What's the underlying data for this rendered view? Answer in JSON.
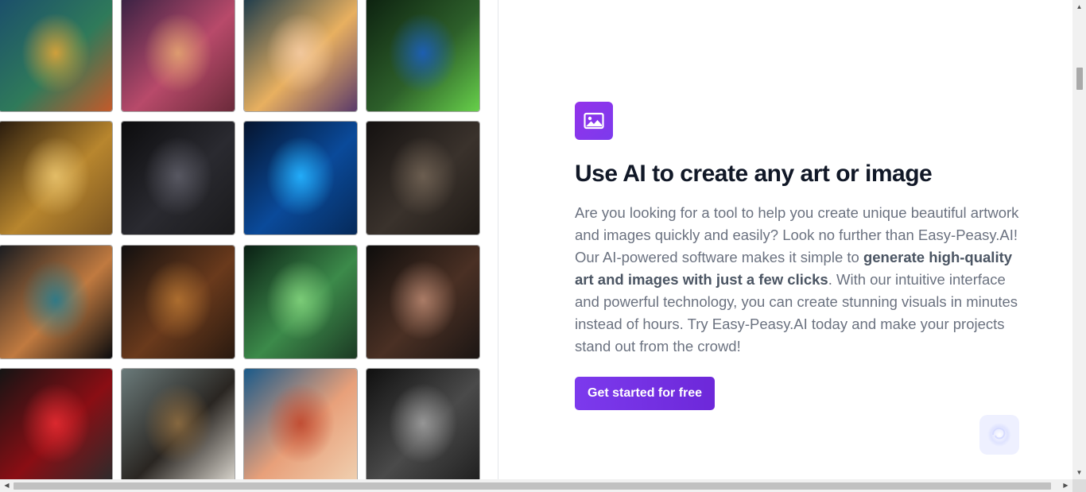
{
  "gallery": {
    "images": [
      {
        "name": "van-gogh-portrait-image",
        "palette": [
          "#1b4f6b",
          "#2f7a5a",
          "#d8a23a",
          "#c45a2a"
        ]
      },
      {
        "name": "floral-woman-portrait-image",
        "palette": [
          "#3a2244",
          "#b84a6a",
          "#e0a070",
          "#6a2a3a"
        ]
      },
      {
        "name": "cartoon-woman-glasses-image",
        "palette": [
          "#1e3c4c",
          "#e8b060",
          "#f3c9a0",
          "#5a3a6a"
        ]
      },
      {
        "name": "blue-beetle-image",
        "palette": [
          "#0d2210",
          "#2d5f2a",
          "#1c5fb8",
          "#67d04a"
        ]
      },
      {
        "name": "golden-retriever-image",
        "palette": [
          "#2a1c0e",
          "#b8862e",
          "#e6c06a",
          "#7a5420"
        ]
      },
      {
        "name": "batman-image",
        "palette": [
          "#0c0c0e",
          "#2a2a30",
          "#5a5a64",
          "#1a1a1c"
        ]
      },
      {
        "name": "hooded-hacker-image",
        "palette": [
          "#05142e",
          "#0a4a9a",
          "#24b2ff",
          "#062a5a"
        ]
      },
      {
        "name": "buddha-statue-image",
        "palette": [
          "#141110",
          "#3a322c",
          "#6e6052",
          "#1f1a16"
        ]
      },
      {
        "name": "butterfly-image",
        "palette": [
          "#1a1c20",
          "#c07a40",
          "#2a7a8a",
          "#0c0c0e"
        ]
      },
      {
        "name": "dog-portrait-image",
        "palette": [
          "#121010",
          "#6a3a1c",
          "#b07030",
          "#2a1a10"
        ]
      },
      {
        "name": "yoda-image",
        "palette": [
          "#0a1f14",
          "#3c8a4a",
          "#7fd07a",
          "#1c3a24"
        ]
      },
      {
        "name": "man-portrait-image",
        "palette": [
          "#0e0d0c",
          "#4a3024",
          "#b0806a",
          "#1c1614"
        ]
      },
      {
        "name": "red-sports-car-image",
        "palette": [
          "#141414",
          "#8a0e14",
          "#e02a30",
          "#2c2c2c"
        ]
      },
      {
        "name": "steam-locomotive-image",
        "palette": [
          "#6a7a7a",
          "#2a2622",
          "#8a6a40",
          "#d8d4cc"
        ]
      },
      {
        "name": "cartoon-old-man-image",
        "palette": [
          "#1a5a8a",
          "#e8a07a",
          "#c04a30",
          "#f0d0b0"
        ]
      },
      {
        "name": "man-fedora-sunglasses-image",
        "palette": [
          "#101010",
          "#4a4a4a",
          "#9a9a9a",
          "#202020"
        ]
      }
    ]
  },
  "feature": {
    "icon": "image-icon",
    "title": "Use AI to create any art or image",
    "body_part1": "Are you looking for a tool to help you create unique beautiful artwork and images quickly and easily? Look no further than Easy-Peasy.AI! Our AI-powered software makes it simple to ",
    "body_bold": "generate high-quality art and images with just a few clicks",
    "body_part2": ". With our intuitive interface and powerful technology, you can create stunning visuals in minutes instead of hours. Try Easy-Peasy.AI today and make your projects stand out from the crowd!",
    "cta_label": "Get started for free"
  },
  "chat_widget": {
    "icon": "chat-assistant-icon"
  },
  "scrollbars": {
    "up_arrow": "▲",
    "down_arrow": "▼",
    "left_arrow": "◀",
    "right_arrow": "▶"
  },
  "colors": {
    "accent": "#7c3aed",
    "title": "#111827",
    "body": "#6b7280"
  }
}
